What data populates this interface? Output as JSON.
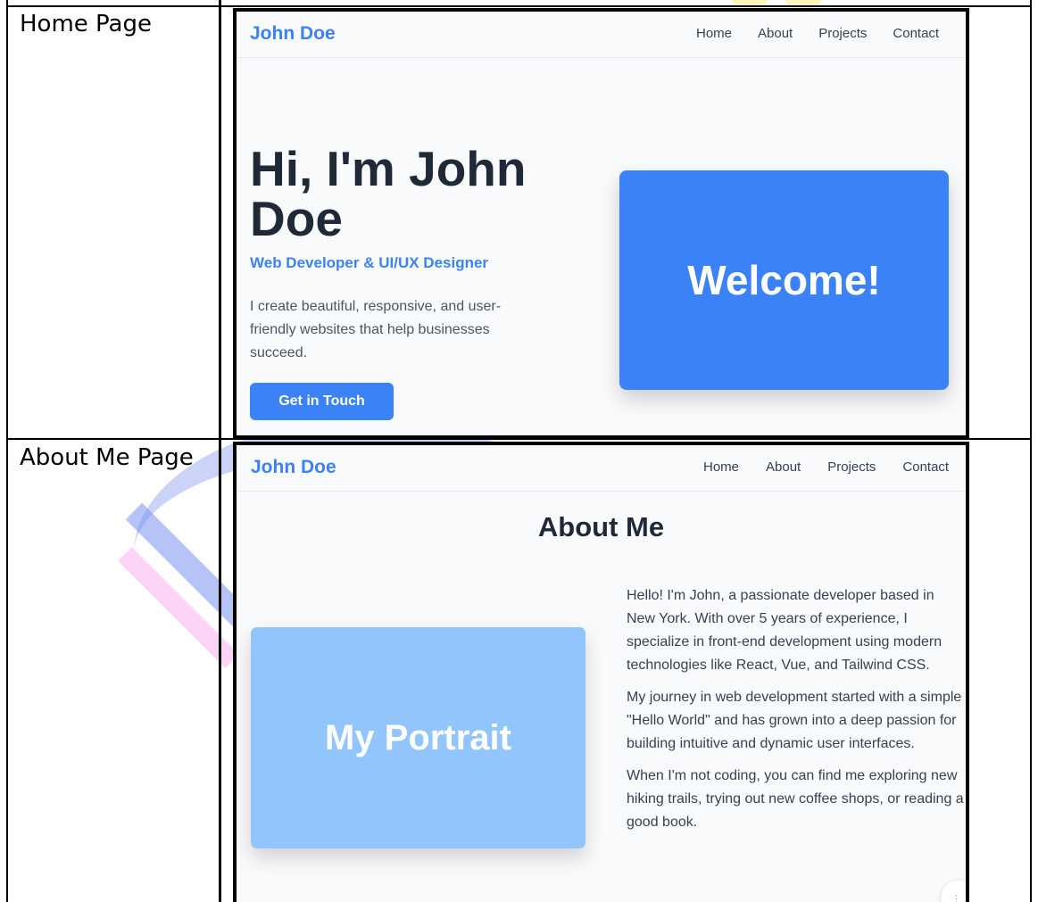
{
  "rows": [
    {
      "label": "Home Page",
      "site": {
        "brand": "John Doe",
        "nav": [
          "Home",
          "About",
          "Projects",
          "Contact"
        ],
        "hero": {
          "heading": "Hi, I'm John Doe",
          "subtitle": "Web Developer & UI/UX Designer",
          "description": "I create beautiful, responsive, and user-friendly websites that help businesses succeed.",
          "cta": "Get in Touch",
          "welcome": "Welcome!"
        }
      }
    },
    {
      "label": "About Me Page",
      "site": {
        "brand": "John Doe",
        "nav": [
          "Home",
          "About",
          "Projects",
          "Contact"
        ],
        "about": {
          "heading": "About Me",
          "portrait": "My Portrait",
          "paragraphs": [
            "Hello! I'm John, a passionate developer based in New York. With over 5 years of experience, I specialize in front-end development using modern technologies like React, Vue, and Tailwind CSS.",
            "My journey in web development started with a simple \"Hello World\" and has grown into a deep passion for building intuitive and dynamic user interfaces.",
            "When I'm not coding, you can find me exploring new hiking trails, trying out new coffee shops, or reading a good book."
          ]
        }
      }
    }
  ],
  "colors": {
    "accent": "#3b82f6",
    "portrait_bg": "#93c5fd",
    "heading": "#1f2937",
    "body_text": "#4b5563",
    "page_bg": "#f9fafb"
  }
}
